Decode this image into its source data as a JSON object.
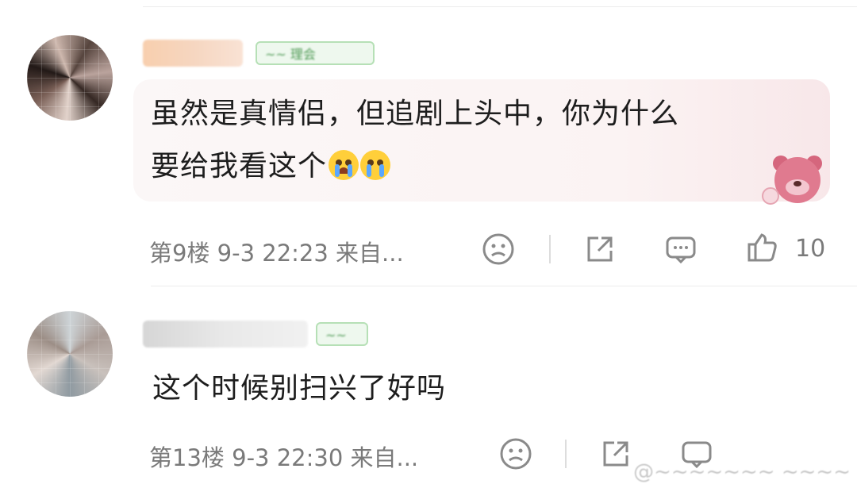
{
  "comments": [
    {
      "floor_info": "第9楼 9-3 22:23 来自...",
      "text_lines": [
        "虽然是真情侣，但追剧上头中，你为什么",
        "要给我看这个"
      ],
      "emojis": [
        "crying-emoji",
        "teary-eyed-emoji"
      ],
      "badge_text": "~~ 理会",
      "likes": "10",
      "actions": [
        "frown-reaction-icon",
        "share-icon",
        "comment-icon",
        "like-thumb-icon"
      ]
    },
    {
      "floor_info": "第13楼 9-3 22:30 来自...",
      "text_lines": [
        "这个时候别扫兴了好吗"
      ],
      "badge_text": "~~",
      "actions": [
        "frown-reaction-icon",
        "share-icon",
        "comment-icon"
      ]
    }
  ],
  "watermark": "@~~~~~~~ ~~~~",
  "colors": {
    "bubble_pink": "#f8e7e9",
    "badge_green": "#4f9a55",
    "meta_gray": "#7a7a7a"
  }
}
